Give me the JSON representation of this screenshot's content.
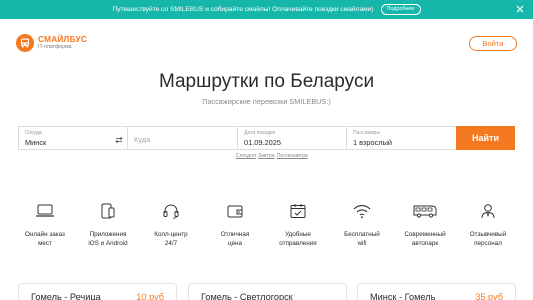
{
  "promo": {
    "text": "Путешествуйте со SMILEBUS и собирайте смайлы! Оплачивайте поездки смайлами)",
    "button": "Подробнее",
    "close_icon": "close-icon"
  },
  "header": {
    "logo_name": "СМАЙЛБУС",
    "logo_sub": "IT-платформа",
    "login": "Войти"
  },
  "hero": {
    "title": "Маршрутки по Беларуси",
    "subtitle": "Пассажирские перевозки SMILEBUS:)"
  },
  "search": {
    "from_label": "Откуда",
    "from_value": "Минск",
    "to_placeholder": "Куда",
    "date_label": "Дата поездки",
    "date_value": "01.09.2025",
    "pass_label": "Пассажиры",
    "pass_value": "1 взрослый",
    "find": "Найти",
    "quick": [
      "Сегодня",
      "Завтра",
      "Послезавтра"
    ]
  },
  "features": [
    {
      "icon": "laptop-icon",
      "line1": "Онлайн заказ",
      "line2": "мест"
    },
    {
      "icon": "mobile-app-icon",
      "line1": "Приложения",
      "line2": "iOS и Android"
    },
    {
      "icon": "headset-icon",
      "line1": "Колл-центр",
      "line2": "24/7"
    },
    {
      "icon": "wallet-icon",
      "line1": "Отличная",
      "line2": "цена"
    },
    {
      "icon": "calendar-check-icon",
      "line1": "Удобные",
      "line2": "отправления"
    },
    {
      "icon": "wifi-icon",
      "line1": "Бесплатный",
      "line2": "wifi"
    },
    {
      "icon": "bus-icon",
      "line1": "Современный",
      "line2": "автопарк"
    },
    {
      "icon": "staff-icon",
      "line1": "Отзывчивый",
      "line2": "персонал"
    }
  ],
  "routes": [
    {
      "name": "Гомель - Речица",
      "price": "10 руб"
    },
    {
      "name": "Гомель - Светлогорск",
      "price": ""
    },
    {
      "name": "Минск - Гомель",
      "price": "35 руб"
    }
  ],
  "colors": {
    "accent": "#f47920",
    "promo": "#17b6aa"
  }
}
